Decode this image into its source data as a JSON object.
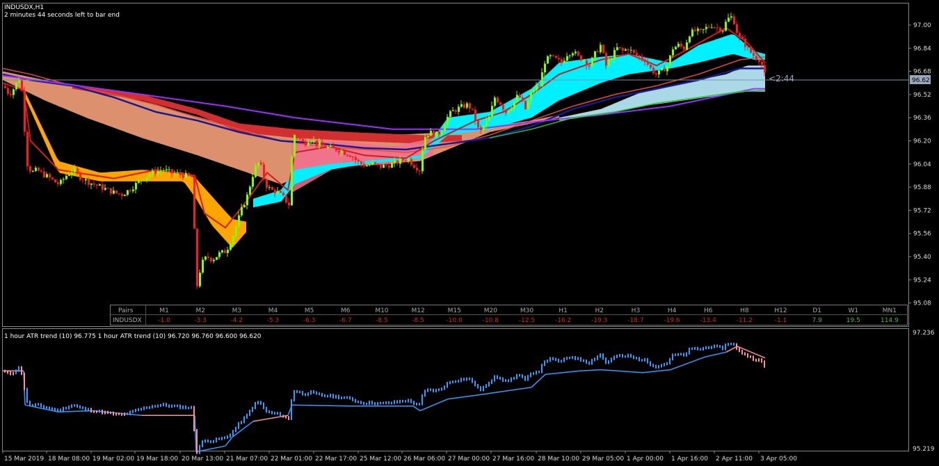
{
  "header": {
    "symbol_timeframe": "INDUSDX,H1",
    "countdown": "2 minutes 44 seconds left to bar end"
  },
  "price_label": {
    "current": "96.62",
    "timer": "<2:44"
  },
  "colors": {
    "bull": "#7fff00",
    "bear": "#ff1a1a",
    "fast_ema": "#d01c1c",
    "slow_ema": "#1a1a8f",
    "cloud_orange": "#ffa500",
    "cloud_salmon": "#f4a07a",
    "cloud_cyan": "#00f0ff",
    "cloud_lightblue": "#aad8e6",
    "purple": "#9b30ff",
    "green_line": "#22cc22",
    "atr_up": "#2e9fff",
    "atr_down": "#ff8fa0"
  },
  "strength_table": {
    "header_label": "Pairs",
    "columns": [
      "M1",
      "M2",
      "M3",
      "M4",
      "M5",
      "M6",
      "M10",
      "M12",
      "M15",
      "M20",
      "M30",
      "H1",
      "H2",
      "H3",
      "H4",
      "H6",
      "H8",
      "H12",
      "D1",
      "W1",
      "MN1"
    ],
    "row_label": "INDUSDX",
    "values": [
      "-1.0",
      "-3.3",
      "-4.2",
      "-5.3",
      "-6.3",
      "-6.7",
      "-8.5",
      "-8.5",
      "-10.0",
      "-10.8",
      "-12.5",
      "-16.2",
      "-19.3",
      "-18.7",
      "-19.6",
      "-13.4",
      "-11.2",
      "-1.1",
      "7.9",
      "19.5",
      "114.9"
    ]
  },
  "atr_panel": {
    "title": "1 hour ATR trend (10) 96.775 1 hour ATR trend (10) 96.720 96.760 96.600 96.620",
    "y_top": "97.236",
    "y_bottom": "95.219"
  },
  "chart_data": {
    "type": "candlestick",
    "symbol": "INDUSDX",
    "timeframe": "H1",
    "y_ticks": [
      "97.00",
      "96.84",
      "96.68",
      "96.52",
      "96.36",
      "96.20",
      "96.04",
      "95.88",
      "95.72",
      "95.56",
      "95.40",
      "95.24",
      "95.08"
    ],
    "ylim": [
      95.0,
      97.13
    ],
    "x_ticks": [
      "15 Mar 2019",
      "18 Mar 08:00",
      "19 Mar 02:00",
      "19 Mar 18:00",
      "20 Mar 13:00",
      "21 Mar 07:00",
      "22 Mar 01:00",
      "22 Mar 17:00",
      "25 Mar 12:00",
      "26 Mar 06:00",
      "27 Mar 00:00",
      "27 Mar 16:00",
      "28 Mar 10:00",
      "29 Mar 05:00",
      "1 Apr 00:00",
      "1 Apr 16:00",
      "2 Apr 11:00",
      "3 Apr 05:00"
    ],
    "close_path": [
      [
        0,
        96.58
      ],
      [
        8,
        96.52
      ],
      [
        14,
        96.56
      ],
      [
        22,
        96.63
      ],
      [
        28,
        96.5
      ],
      [
        32,
        96.06
      ],
      [
        40,
        95.98
      ],
      [
        48,
        96.0
      ],
      [
        56,
        95.97
      ],
      [
        64,
        95.95
      ],
      [
        72,
        95.92
      ],
      [
        80,
        95.9
      ],
      [
        90,
        95.96
      ],
      [
        100,
        96.0
      ],
      [
        110,
        95.95
      ],
      [
        120,
        95.92
      ],
      [
        130,
        95.9
      ],
      [
        140,
        95.88
      ],
      [
        150,
        95.86
      ],
      [
        160,
        95.84
      ],
      [
        170,
        95.83
      ],
      [
        180,
        95.86
      ],
      [
        190,
        95.9
      ],
      [
        200,
        95.94
      ],
      [
        210,
        95.97
      ],
      [
        220,
        95.99
      ],
      [
        230,
        96.0
      ],
      [
        240,
        95.98
      ],
      [
        250,
        95.97
      ],
      [
        260,
        95.96
      ],
      [
        270,
        95.95
      ],
      [
        278,
        95.2
      ],
      [
        284,
        95.35
      ],
      [
        292,
        95.4
      ],
      [
        300,
        95.38
      ],
      [
        310,
        95.42
      ],
      [
        320,
        95.44
      ],
      [
        330,
        95.55
      ],
      [
        340,
        95.7
      ],
      [
        350,
        95.82
      ],
      [
        360,
        96.0
      ],
      [
        368,
        96.06
      ],
      [
        376,
        95.9
      ],
      [
        384,
        95.86
      ],
      [
        392,
        95.85
      ],
      [
        400,
        95.82
      ],
      [
        410,
        95.76
      ],
      [
        416,
        96.25
      ],
      [
        424,
        96.22
      ],
      [
        432,
        96.18
      ],
      [
        440,
        96.22
      ],
      [
        450,
        96.18
      ],
      [
        460,
        96.16
      ],
      [
        470,
        96.15
      ],
      [
        480,
        96.14
      ],
      [
        490,
        96.12
      ],
      [
        500,
        96.1
      ],
      [
        510,
        96.05
      ],
      [
        520,
        96.03
      ],
      [
        530,
        96.04
      ],
      [
        540,
        96.02
      ],
      [
        550,
        96.03
      ],
      [
        560,
        96.04
      ],
      [
        570,
        96.06
      ],
      [
        580,
        96.08
      ],
      [
        590,
        96.03
      ],
      [
        598,
        96.0
      ],
      [
        604,
        96.22
      ],
      [
        612,
        96.26
      ],
      [
        620,
        96.24
      ],
      [
        628,
        96.26
      ],
      [
        636,
        96.35
      ],
      [
        644,
        96.4
      ],
      [
        652,
        96.42
      ],
      [
        660,
        96.44
      ],
      [
        668,
        96.45
      ],
      [
        676,
        96.38
      ],
      [
        684,
        96.25
      ],
      [
        690,
        96.3
      ],
      [
        698,
        96.36
      ],
      [
        706,
        96.5
      ],
      [
        714,
        96.46
      ],
      [
        722,
        96.4
      ],
      [
        730,
        96.44
      ],
      [
        740,
        96.52
      ],
      [
        750,
        96.42
      ],
      [
        760,
        96.55
      ],
      [
        770,
        96.58
      ],
      [
        778,
        96.75
      ],
      [
        786,
        96.78
      ],
      [
        794,
        96.76
      ],
      [
        802,
        96.74
      ],
      [
        810,
        96.8
      ],
      [
        818,
        96.82
      ],
      [
        826,
        96.78
      ],
      [
        834,
        96.76
      ],
      [
        842,
        96.72
      ],
      [
        850,
        96.8
      ],
      [
        858,
        96.86
      ],
      [
        866,
        96.72
      ],
      [
        874,
        96.78
      ],
      [
        882,
        96.84
      ],
      [
        890,
        96.82
      ],
      [
        898,
        96.84
      ],
      [
        906,
        96.8
      ],
      [
        914,
        96.78
      ],
      [
        922,
        96.76
      ],
      [
        930,
        96.7
      ],
      [
        938,
        96.66
      ],
      [
        946,
        96.68
      ],
      [
        954,
        96.72
      ],
      [
        962,
        96.84
      ],
      [
        970,
        96.86
      ],
      [
        978,
        96.84
      ],
      [
        986,
        96.94
      ],
      [
        994,
        96.96
      ],
      [
        1002,
        96.95
      ],
      [
        1010,
        96.98
      ],
      [
        1018,
        97.0
      ],
      [
        1026,
        96.98
      ],
      [
        1034,
        96.97
      ],
      [
        1040,
        97.04
      ],
      [
        1048,
        97.06
      ],
      [
        1056,
        96.92
      ],
      [
        1064,
        96.88
      ],
      [
        1072,
        96.82
      ],
      [
        1080,
        96.78
      ],
      [
        1088,
        96.76
      ],
      [
        1096,
        96.62
      ]
    ],
    "fast_ema_path": [
      [
        0,
        96.6
      ],
      [
        30,
        96.55
      ],
      [
        40,
        96.2
      ],
      [
        80,
        96.0
      ],
      [
        160,
        95.94
      ],
      [
        220,
        96.0
      ],
      [
        276,
        95.96
      ],
      [
        290,
        95.7
      ],
      [
        320,
        95.6
      ],
      [
        350,
        95.78
      ],
      [
        380,
        95.98
      ],
      [
        410,
        95.86
      ],
      [
        420,
        96.12
      ],
      [
        470,
        96.16
      ],
      [
        520,
        96.1
      ],
      [
        580,
        96.08
      ],
      [
        620,
        96.2
      ],
      [
        680,
        96.34
      ],
      [
        720,
        96.4
      ],
      [
        760,
        96.52
      ],
      [
        800,
        96.66
      ],
      [
        860,
        96.76
      ],
      [
        900,
        96.8
      ],
      [
        940,
        96.72
      ],
      [
        980,
        96.82
      ],
      [
        1040,
        96.98
      ],
      [
        1070,
        96.88
      ],
      [
        1096,
        96.74
      ]
    ],
    "slow_ema_path": [
      [
        0,
        96.7
      ],
      [
        40,
        96.66
      ],
      [
        100,
        96.58
      ],
      [
        160,
        96.52
      ],
      [
        220,
        96.45
      ],
      [
        280,
        96.36
      ],
      [
        340,
        96.28
      ],
      [
        400,
        96.2
      ],
      [
        460,
        96.16
      ],
      [
        520,
        96.14
      ],
      [
        580,
        96.12
      ],
      [
        640,
        96.16
      ],
      [
        700,
        96.24
      ],
      [
        760,
        96.34
      ],
      [
        820,
        96.44
      ],
      [
        880,
        96.52
      ],
      [
        940,
        96.58
      ],
      [
        1000,
        96.66
      ],
      [
        1060,
        96.76
      ],
      [
        1096,
        96.78
      ]
    ],
    "blue_line_path": [
      [
        0,
        96.66
      ],
      [
        40,
        96.62
      ],
      [
        100,
        96.58
      ],
      [
        160,
        96.5
      ],
      [
        220,
        96.4
      ],
      [
        280,
        96.34
      ],
      [
        340,
        96.26
      ],
      [
        400,
        96.2
      ],
      [
        460,
        96.18
      ],
      [
        520,
        96.15
      ],
      [
        580,
        96.14
      ],
      [
        640,
        96.18
      ],
      [
        700,
        96.22
      ],
      [
        760,
        96.3
      ],
      [
        820,
        96.42
      ],
      [
        880,
        96.5
      ],
      [
        940,
        96.56
      ],
      [
        1000,
        96.62
      ],
      [
        1060,
        96.7
      ],
      [
        1096,
        96.7
      ]
    ],
    "purple_line_path": [
      [
        0,
        96.65
      ],
      [
        80,
        96.6
      ],
      [
        200,
        96.52
      ],
      [
        320,
        96.44
      ],
      [
        420,
        96.36
      ],
      [
        560,
        96.28
      ],
      [
        680,
        96.28
      ],
      [
        780,
        96.34
      ],
      [
        860,
        96.38
      ],
      [
        960,
        96.44
      ],
      [
        1040,
        96.52
      ],
      [
        1080,
        96.56
      ],
      [
        1096,
        96.56
      ]
    ],
    "green_line_path": [
      [
        700,
        96.22
      ],
      [
        760,
        96.28
      ],
      [
        820,
        96.36
      ],
      [
        880,
        96.4
      ],
      [
        940,
        96.46
      ],
      [
        1000,
        96.5
      ],
      [
        1060,
        96.54
      ],
      [
        1096,
        96.55
      ]
    ],
    "atr_trail_path": [
      [
        0,
        96.58
      ],
      [
        30,
        96.58
      ],
      [
        32,
        96.0
      ],
      [
        80,
        95.88
      ],
      [
        130,
        95.9
      ],
      [
        200,
        95.82
      ],
      [
        276,
        95.82
      ],
      [
        278,
        95.2
      ],
      [
        320,
        95.3
      ],
      [
        330,
        95.45
      ],
      [
        360,
        95.72
      ],
      [
        410,
        95.82
      ],
      [
        416,
        96.0
      ],
      [
        500,
        95.98
      ],
      [
        590,
        95.98
      ],
      [
        600,
        95.9
      ],
      [
        640,
        96.1
      ],
      [
        690,
        96.18
      ],
      [
        760,
        96.3
      ],
      [
        780,
        96.52
      ],
      [
        830,
        96.58
      ],
      [
        860,
        96.6
      ],
      [
        920,
        96.55
      ],
      [
        960,
        96.6
      ],
      [
        1010,
        96.82
      ],
      [
        1040,
        96.9
      ],
      [
        1056,
        97.0
      ],
      [
        1096,
        96.8
      ]
    ]
  }
}
